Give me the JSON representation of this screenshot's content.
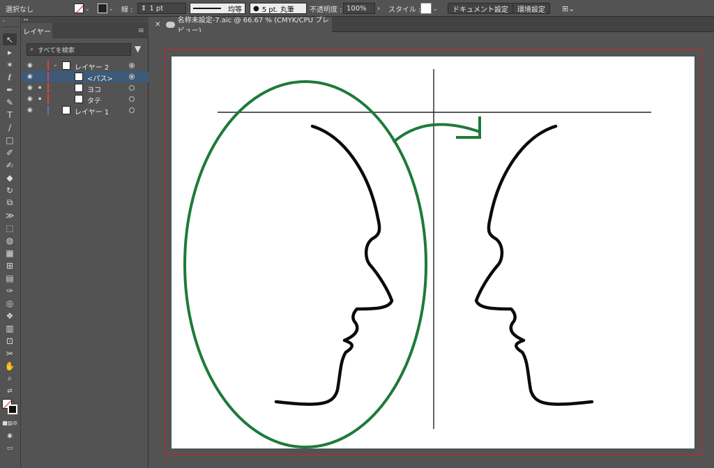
{
  "control_bar": {
    "selection_label": "選択なし",
    "stroke_label": "線 :",
    "stroke_weight": "1 pt",
    "stroke_profile": "均等",
    "brush_label": "5 pt. 丸筆",
    "opacity_label": "不透明度 :",
    "opacity_value": "100%",
    "style_label": "スタイル :",
    "document_settings_button": "ドキュメント設定",
    "preferences_button": "環境設定"
  },
  "layers_panel": {
    "tab_label": "レイヤー",
    "search_placeholder": "すべてを検索",
    "layers": [
      {
        "name": "レイヤー 2",
        "color": "#e04040"
      },
      {
        "name": "<パス>",
        "color": "#e04040"
      },
      {
        "name": "ヨコ",
        "color": "#e04040"
      },
      {
        "name": "タテ",
        "color": "#e04040"
      },
      {
        "name": "レイヤー 1",
        "color": "#4a78d0"
      }
    ]
  },
  "document": {
    "tab_title": "名称未設定-7.aic @ 66.67 % (CMYK/CPU プレビュー)"
  },
  "colors": {
    "ellipse": "#1e7a3a",
    "arrow": "#1e7a3a",
    "bleed": "#d0242a",
    "selection": "#3d5a78"
  }
}
